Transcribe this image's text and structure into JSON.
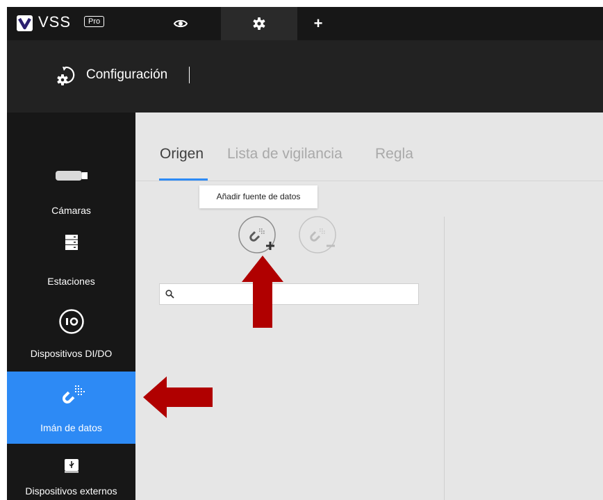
{
  "topbar": {
    "brand": "VSS",
    "badge": "Pro",
    "tabs": [
      {
        "name": "live-view",
        "icon": "eye-icon"
      },
      {
        "name": "settings",
        "icon": "gear-icon",
        "active": true
      },
      {
        "name": "add-tab",
        "icon": "plus-icon",
        "glyph": "+"
      }
    ]
  },
  "header": {
    "icon": "settings-gear-arrow-icon",
    "title": "Configuración"
  },
  "sidebar": {
    "items": [
      {
        "label": "Cámaras",
        "icon": "camera-icon"
      },
      {
        "label": "Estaciones",
        "icon": "server-icon"
      },
      {
        "label": "Dispositivos DI/DO",
        "icon": "io-icon"
      },
      {
        "label": "Imán de datos",
        "icon": "data-magnet-icon",
        "active": true
      },
      {
        "label": "Dispositivos externos",
        "icon": "usb-drive-icon"
      }
    ]
  },
  "content": {
    "tabs": [
      {
        "label": "Origen",
        "active": true
      },
      {
        "label": "Lista de vigilancia"
      },
      {
        "label": "Regla"
      }
    ],
    "tooltip": "Añadir fuente de datos",
    "toolbar": {
      "add_icon": "magnet-add-icon",
      "remove_icon": "magnet-remove-icon"
    },
    "search": {
      "icon": "search-icon",
      "value": "",
      "placeholder": ""
    }
  },
  "colors": {
    "accent": "#2d8af5",
    "topbar": "#171717",
    "header": "#222222",
    "annotation_arrow": "#b00000"
  }
}
